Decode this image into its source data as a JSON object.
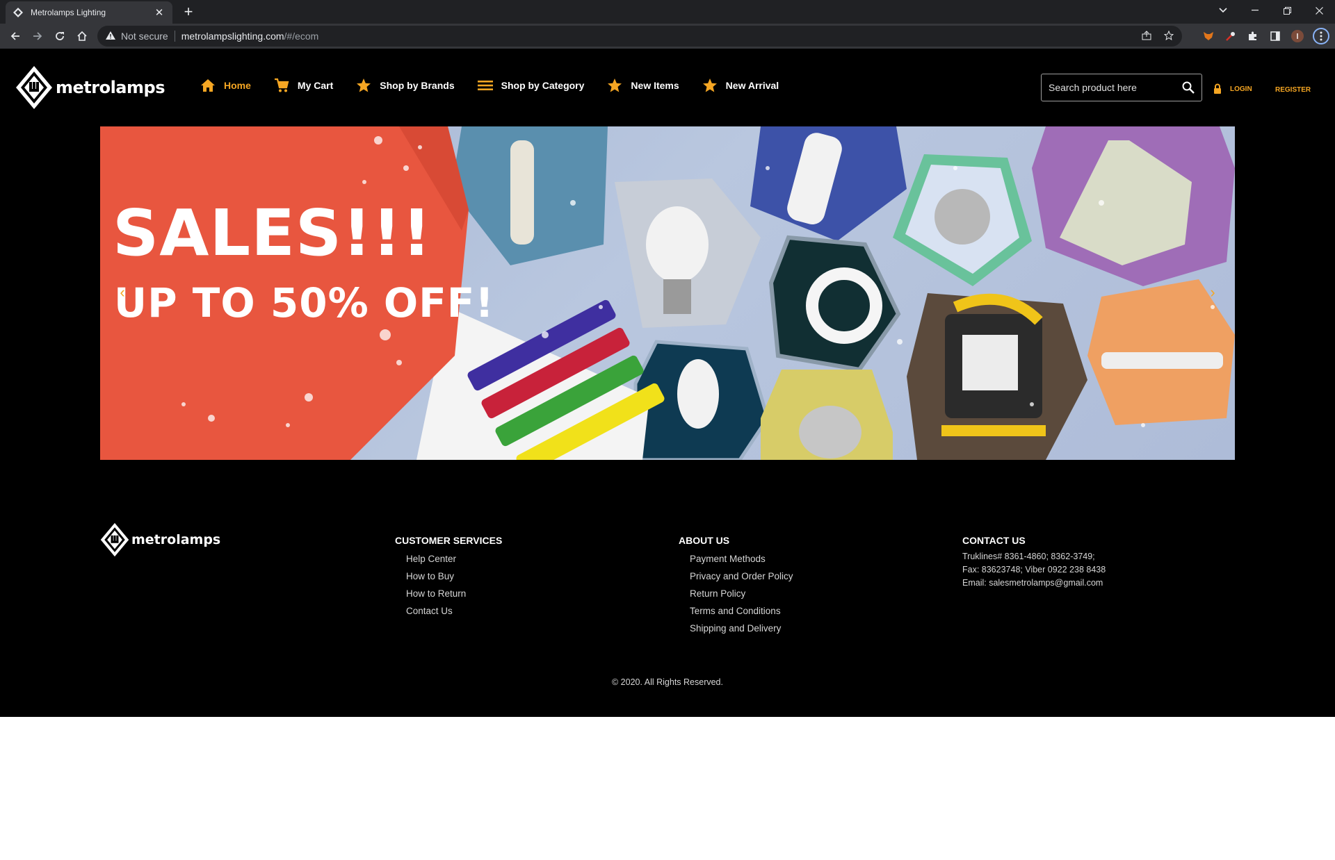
{
  "browser": {
    "tab_title": "Metrolamps Lighting",
    "tab_close": "✕",
    "new_tab": "+",
    "security_label": "Not secure",
    "url_host": "metrolampslighting.com",
    "url_path": "/#/ecom"
  },
  "header": {
    "logo_text": "metrolamps",
    "nav": [
      {
        "label": "Home",
        "icon": "home-icon",
        "active": true
      },
      {
        "label": "My Cart",
        "icon": "cart-icon"
      },
      {
        "label": "Shop by Brands",
        "icon": "star-icon"
      },
      {
        "label": "Shop by Category",
        "icon": "menu-icon"
      },
      {
        "label": "New Items",
        "icon": "star-icon"
      },
      {
        "label": "New Arrival",
        "icon": "star-icon"
      }
    ],
    "search_placeholder": "Search product here",
    "login_label": "LOGIN",
    "register_label": "REGISTER"
  },
  "banner": {
    "headline": "SALES!!!",
    "subheadline": "UP TO 50%  OFF!",
    "prev_arrow": "‹",
    "next_arrow": "›"
  },
  "footer": {
    "logo_text": "metrolamps",
    "customer_services": {
      "title": "CUSTOMER SERVICES",
      "links": [
        "Help Center",
        "How to Buy",
        "How to Return",
        "Contact Us"
      ]
    },
    "about_us": {
      "title": "ABOUT US",
      "links": [
        "Payment Methods",
        "Privacy and Order Policy",
        "Return Policy",
        "Terms and Conditions",
        "Shipping and Delivery"
      ]
    },
    "contact_us": {
      "title": "CONTACT US",
      "lines": [
        "Truklines# 8361-4860; 8362-3749;",
        "Fax: 83623748; Viber 0922 238 8438",
        "Email: salesmetrolamps@gmail.com"
      ]
    },
    "copyright": "© 2020. All Rights Reserved."
  },
  "colors": {
    "accent": "#f5a623",
    "site_bg": "#000000",
    "chrome_dark": "#202124",
    "chrome_mid": "#35363a",
    "banner_red": "#e8563f"
  }
}
